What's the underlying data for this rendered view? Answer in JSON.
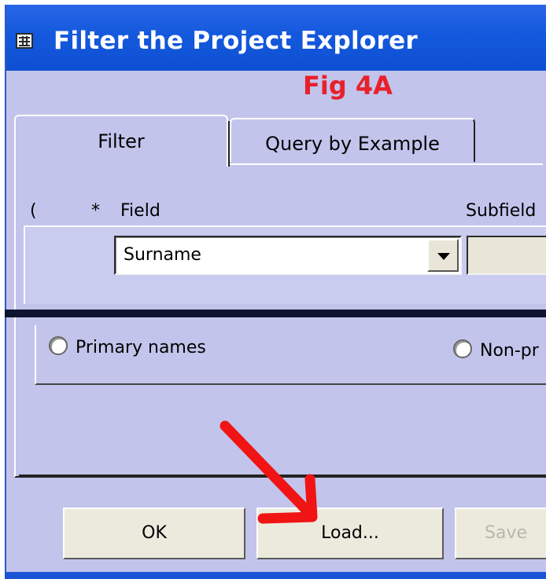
{
  "window": {
    "title": "Filter the Project Explorer",
    "title_icon": "table-icon",
    "titlebar_color": "#1459dd"
  },
  "annotation": {
    "fig_label": "Fig 4A",
    "fig_color": "#e8202a",
    "arrow_icon": "red-arrow-icon"
  },
  "tabs": [
    {
      "label": "Filter",
      "selected": true
    },
    {
      "label": "Query by Example",
      "selected": false
    }
  ],
  "grid": {
    "headers": {
      "paren": "(",
      "star": "*",
      "field": "Field",
      "subfield": "Subfield"
    },
    "row": {
      "field_value": "Surname",
      "subfield_value": ""
    }
  },
  "radios": [
    {
      "label": "Primary names",
      "checked": false
    },
    {
      "label": "Non-pr",
      "checked": false
    }
  ],
  "buttons": {
    "ok": "OK",
    "load": "Load...",
    "save": "Save"
  }
}
